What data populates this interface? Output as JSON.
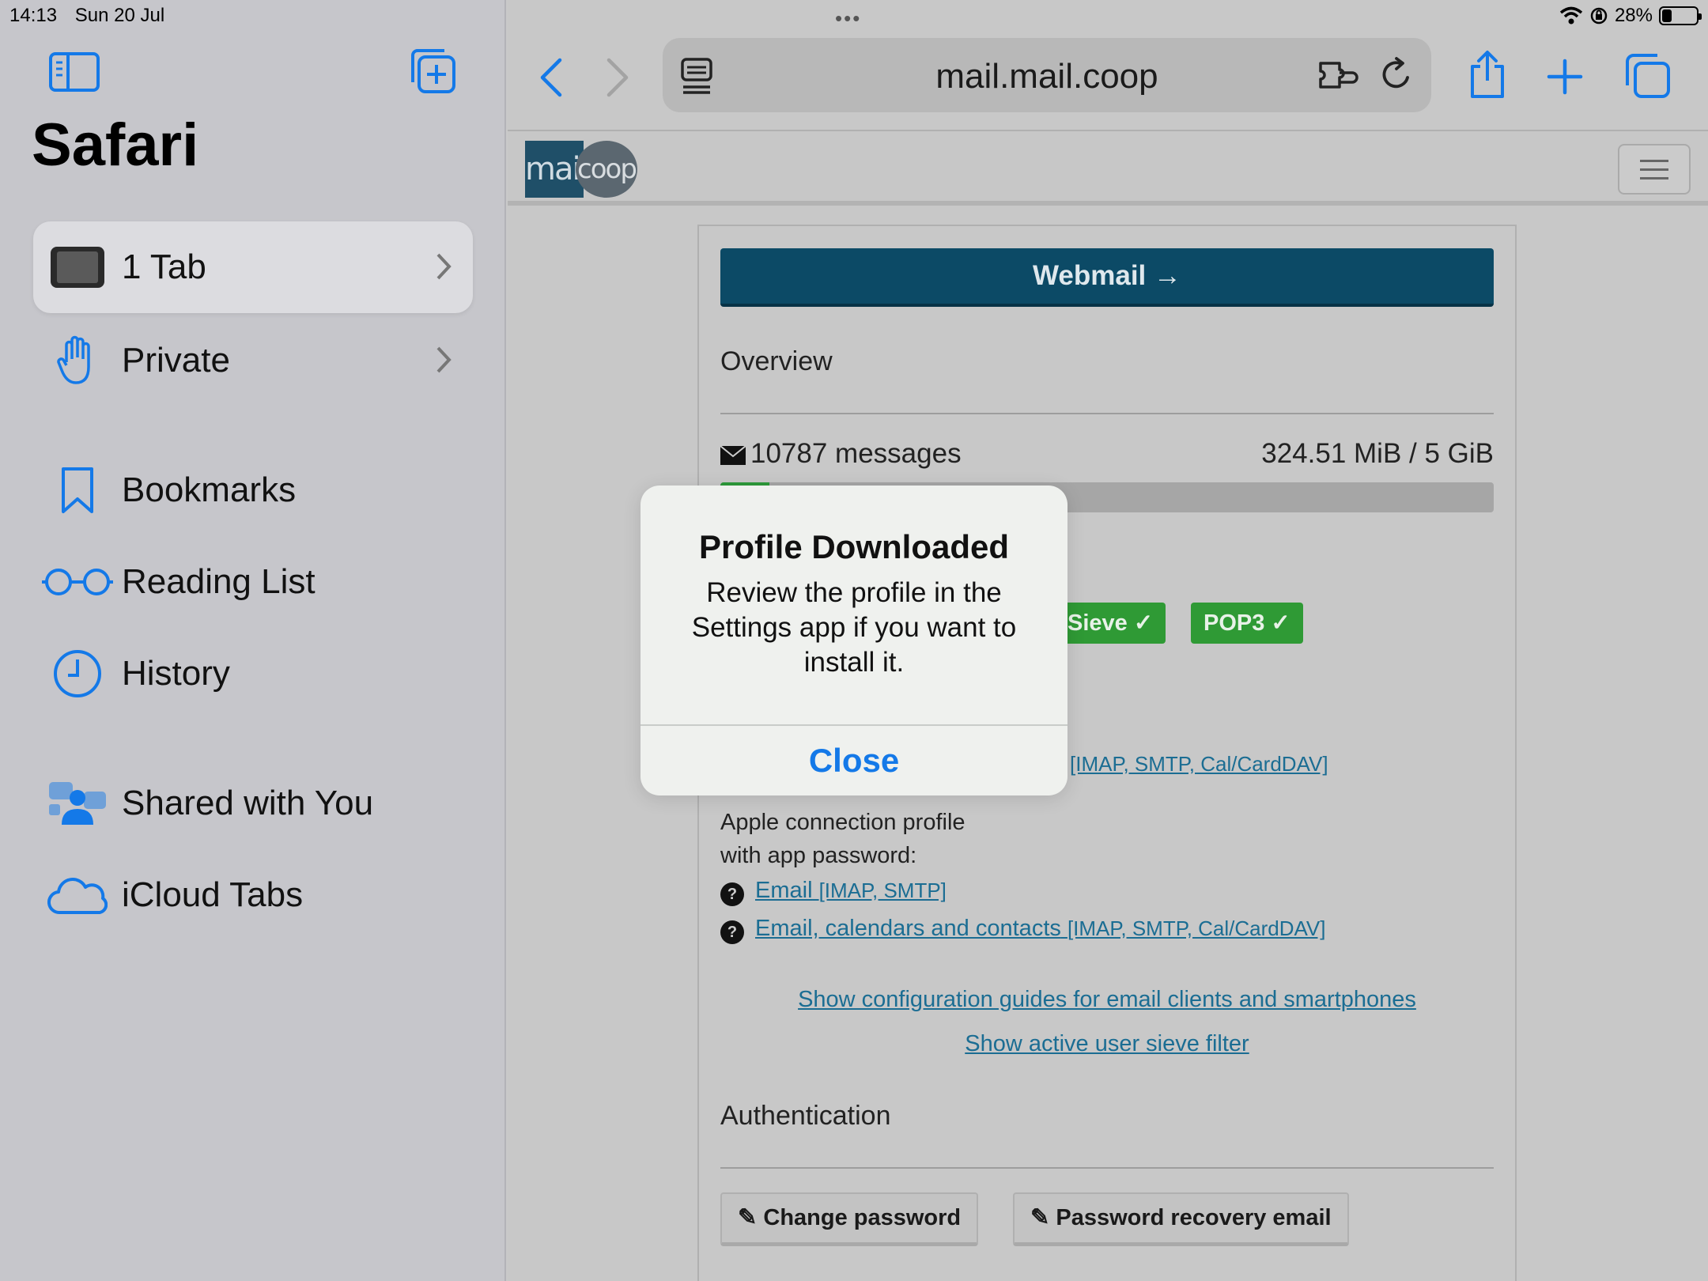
{
  "status": {
    "time": "14:13",
    "date": "Sun 20 Jul",
    "battery": "28%",
    "battery_level": 0.28
  },
  "sidebar": {
    "title": "Safari",
    "items": [
      {
        "label": "1 Tab",
        "icon": "tab-icon"
      },
      {
        "label": "Private",
        "icon": "hand-icon"
      },
      {
        "label": "Bookmarks",
        "icon": "bookmark-icon"
      },
      {
        "label": "Reading List",
        "icon": "glasses-icon"
      },
      {
        "label": "History",
        "icon": "clock-icon"
      },
      {
        "label": "Shared with You",
        "icon": "people-icon"
      },
      {
        "label": "iCloud Tabs",
        "icon": "cloud-icon"
      }
    ]
  },
  "toolbar": {
    "url": "mail.mail.coop"
  },
  "site": {
    "logo": {
      "main": "mail",
      "circle": "coop"
    },
    "webmail_label": "Webmail →",
    "overview_heading": "Overview",
    "messages": "10787 messages",
    "quota": "324.51 MiB / 5 GiB",
    "quota_fraction": 0.063,
    "badges": [
      "Sieve ✓",
      "POP3 ✓"
    ],
    "partial_link_small": "[IMAP, SMTP, Cal/CardDAV]",
    "apple_profile_line1": "Apple connection profile",
    "apple_profile_line2": "with app password:",
    "profile_links": [
      {
        "text": "Email",
        "tag": "[IMAP, SMTP]"
      },
      {
        "text": "Email, calendars and contacts",
        "tag": "[IMAP, SMTP, Cal/CardDAV]"
      }
    ],
    "config_guides_link": "Show configuration guides for email clients and smartphones",
    "sieve_link": "Show active user sieve filter",
    "auth_heading": "Authentication",
    "change_password": "Change password",
    "recovery_email": "Password recovery email"
  },
  "alert": {
    "title": "Profile Downloaded",
    "message": "Review the profile in the Settings app if you want to install it.",
    "button": "Close"
  },
  "colors": {
    "accent": "#1479e8",
    "webmail": "#0c4a66",
    "badge_green": "#2f9a35",
    "link": "#1b6d93"
  }
}
